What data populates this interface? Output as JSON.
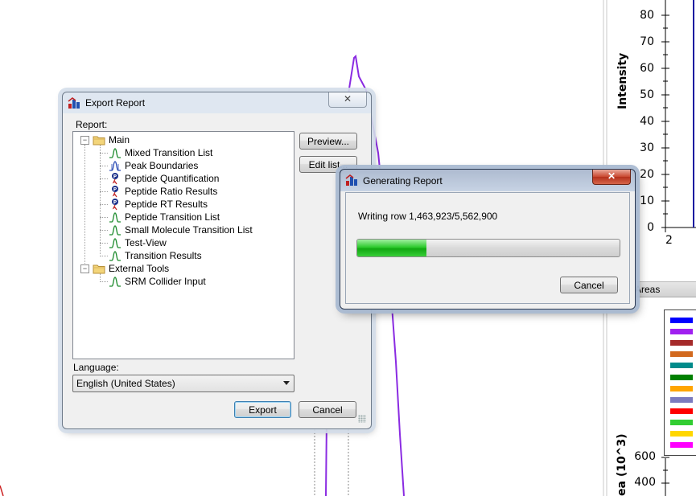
{
  "background_app": {
    "y_axis_title": "Intensity",
    "y_ticks": [
      "80",
      "70",
      "60",
      "50",
      "40",
      "30",
      "20",
      "10",
      "0"
    ],
    "x_tick_partial": "2",
    "areas_tab_label": "Areas",
    "lower_axis_title": "ea (10^3)",
    "lower_ticks": [
      "600",
      "400"
    ],
    "legend_colors": [
      "#0000ff",
      "#a020f0",
      "#a52a2a",
      "#d2691e",
      "#008b8b",
      "#008000",
      "#ffa500",
      "#7b7bbf",
      "#ff0000",
      "#32cd32",
      "#ffd700",
      "#ff00ff"
    ]
  },
  "export_dialog": {
    "title": "Export Report",
    "close_glyph": "✕",
    "report_label": "Report:",
    "tree": [
      {
        "label": "Main",
        "type": "folder",
        "expanded": true,
        "expander": "−"
      },
      {
        "label": "Mixed Transition List",
        "type": "peak-green"
      },
      {
        "label": "Peak Boundaries",
        "type": "peak-blue"
      },
      {
        "label": "Peptide Quantification",
        "type": "peptide"
      },
      {
        "label": "Peptide Ratio Results",
        "type": "peptide"
      },
      {
        "label": "Peptide RT Results",
        "type": "peptide"
      },
      {
        "label": "Peptide Transition List",
        "type": "peak-green"
      },
      {
        "label": "Small Molecule Transition List",
        "type": "peak-green"
      },
      {
        "label": "Test-View",
        "type": "peak-green"
      },
      {
        "label": "Transition Results",
        "type": "peak-green"
      },
      {
        "label": "External Tools",
        "type": "folder",
        "expanded": true,
        "expander": "−"
      },
      {
        "label": "SRM Collider Input",
        "type": "peak-green"
      }
    ],
    "preview_button": "Preview...",
    "edit_list_button": "Edit list...",
    "language_label": "Language:",
    "language_value": "English (United States)",
    "export_button": "Export",
    "cancel_button": "Cancel"
  },
  "progress_dialog": {
    "title": "Generating Report",
    "close_glyph": "✕",
    "status_text": "Writing row 1,463,923/5,562,900",
    "progress_fraction": 0.263,
    "cancel_button": "Cancel"
  }
}
